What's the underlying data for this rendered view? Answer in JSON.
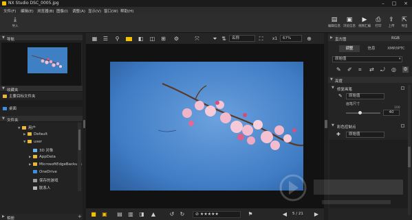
{
  "window": {
    "title": "NX Studio    DSC_0005.jpg"
  },
  "menu": [
    "文件(F)",
    "编辑(E)",
    "浏览器(B)",
    "图像(I)",
    "调整(A)",
    "显示(V)",
    "窗口(W)",
    "帮助(H)"
  ],
  "toolbar": {
    "import_label": "导入",
    "right_buttons": [
      {
        "label": "编辑信息",
        "icon": "edit-info-icon"
      },
      {
        "label": "浏览信息",
        "icon": "browse-info-icon"
      },
      {
        "label": "视频汇编",
        "icon": "video-editor-icon"
      },
      {
        "label": "打印",
        "icon": "print-icon"
      },
      {
        "label": "上传",
        "icon": "upload-icon"
      },
      {
        "label": "导出",
        "icon": "export-icon"
      }
    ]
  },
  "left_panel": {
    "navigator_label": "导航",
    "favorites_label": "收藏夹",
    "favorites_item": "主要目标文件夹",
    "desktop_label": "桌面",
    "folders_label": "文件夹",
    "tree": [
      {
        "label": "用户",
        "indent": 0,
        "arrow": "▼"
      },
      {
        "label": "Default",
        "indent": 1,
        "arrow": "▶"
      },
      {
        "label": "user",
        "indent": 1,
        "arrow": "▼"
      },
      {
        "label": "3D 对象",
        "indent": 2,
        "arrow": ""
      },
      {
        "label": "AppData",
        "indent": 2,
        "arrow": "▶"
      },
      {
        "label": "MicrosoftEdgeBackups",
        "indent": 2,
        "arrow": "▶"
      },
      {
        "label": "OneDrive",
        "indent": 2,
        "arrow": ""
      },
      {
        "label": "保存的游戏",
        "indent": 2,
        "arrow": ""
      },
      {
        "label": "联系人",
        "indent": 2,
        "arrow": ""
      }
    ],
    "album_label": "相册"
  },
  "viewbar": {
    "sort_label": "名称",
    "zoom_value": "67%"
  },
  "bottombar": {
    "page_counter": "5 / 21"
  },
  "right_panel": {
    "header_label": "直方图",
    "color_space": "RGB",
    "tabs": [
      "调整",
      "信息",
      "XMP/IPTC"
    ],
    "preset_value": "原始值",
    "section_basic": "亮度",
    "retouch_label": "修复画笔",
    "retouch_value": "原始值",
    "brush_size_label": "画笔尺寸",
    "brush_max": "100",
    "brush_value": "40",
    "color_control_label": "彩色控制点",
    "color_control_value": "原始值"
  },
  "colors": {
    "accent_yellow": "#f2c200",
    "folder": "#e9b83b",
    "sky": "#4b86c9"
  }
}
